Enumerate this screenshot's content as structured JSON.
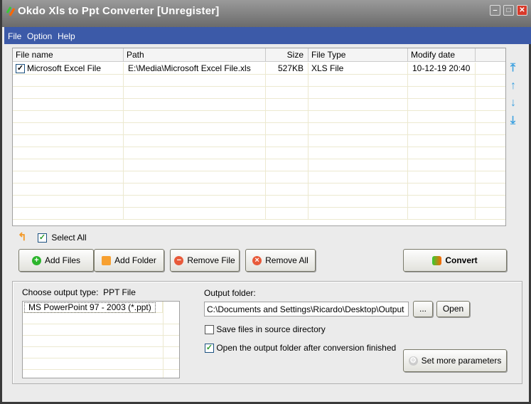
{
  "window": {
    "title": "Okdo Xls to Ppt Converter [Unregister]",
    "controls": [
      "minimize",
      "maximize",
      "close"
    ]
  },
  "menu": [
    "File",
    "Option",
    "Help"
  ],
  "file_list": {
    "columns": [
      "File name",
      "Path",
      "Size",
      "File Type",
      "Modify date"
    ],
    "rows": [
      {
        "checked": true,
        "name": "Microsoft Excel File",
        "path": "E:\\Media\\Microsoft Excel File.xls",
        "size": "527KB",
        "type": "XLS File",
        "date": "10-12-19 20:40"
      }
    ]
  },
  "side_icons": [
    "move-top-icon",
    "move-up-icon",
    "move-down-icon",
    "move-bottom-icon"
  ],
  "select_all": {
    "label": "Select All",
    "checked": true
  },
  "buttons": {
    "add_files": "Add Files",
    "add_folder": "Add Folder",
    "remove_file": "Remove File",
    "remove_all": "Remove All",
    "convert": "Convert"
  },
  "output": {
    "type_label": "Choose output type:",
    "type_value": "PPT File",
    "types": [
      "MS PowerPoint 97 - 2003 (*.ppt)"
    ],
    "folder_label": "Output folder:",
    "folder_value": "C:\\Documents and Settings\\Ricardo\\Desktop\\Output",
    "browse": "...",
    "open": "Open",
    "save_in_source": {
      "label": "Save files in source directory",
      "checked": false
    },
    "open_after": {
      "label": "Open the output folder after conversion finished",
      "checked": true
    },
    "more_params": "Set more parameters"
  }
}
